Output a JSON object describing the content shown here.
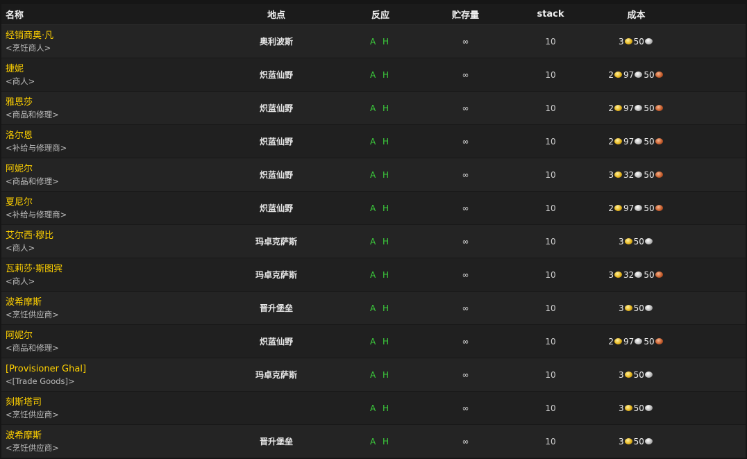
{
  "headers": {
    "name": "名称",
    "location": "地点",
    "react": "反应",
    "stock": "贮存量",
    "stack": "stack",
    "cost": "成本"
  },
  "rows": [
    {
      "name": "经销商奥·凡",
      "sub": "<烹饪商人>",
      "location": "奥利波斯",
      "react": "A H",
      "stock": "∞",
      "stack": "10",
      "gold": "3",
      "silver": "50",
      "copper": ""
    },
    {
      "name": "捷妮",
      "sub": "<商人>",
      "location": "炽蓝仙野",
      "react": "A H",
      "stock": "∞",
      "stack": "10",
      "gold": "2",
      "silver": "97",
      "copper": "50"
    },
    {
      "name": "雅恩莎",
      "sub": "<商品和修理>",
      "location": "炽蓝仙野",
      "react": "A H",
      "stock": "∞",
      "stack": "10",
      "gold": "2",
      "silver": "97",
      "copper": "50"
    },
    {
      "name": "洛尔恩",
      "sub": "<补给与修理商>",
      "location": "炽蓝仙野",
      "react": "A H",
      "stock": "∞",
      "stack": "10",
      "gold": "2",
      "silver": "97",
      "copper": "50"
    },
    {
      "name": "阿妮尔",
      "sub": "<商品和修理>",
      "location": "炽蓝仙野",
      "react": "A H",
      "stock": "∞",
      "stack": "10",
      "gold": "3",
      "silver": "32",
      "copper": "50"
    },
    {
      "name": "夏尼尔",
      "sub": "<补给与修理商>",
      "location": "炽蓝仙野",
      "react": "A H",
      "stock": "∞",
      "stack": "10",
      "gold": "2",
      "silver": "97",
      "copper": "50"
    },
    {
      "name": "艾尔西·穆比",
      "sub": "<商人>",
      "location": "玛卓克萨斯",
      "react": "A H",
      "stock": "∞",
      "stack": "10",
      "gold": "3",
      "silver": "50",
      "copper": ""
    },
    {
      "name": "瓦莉莎·斯图宾",
      "sub": "<商人>",
      "location": "玛卓克萨斯",
      "react": "A H",
      "stock": "∞",
      "stack": "10",
      "gold": "3",
      "silver": "32",
      "copper": "50"
    },
    {
      "name": "波希摩斯",
      "sub": "<烹饪供应商>",
      "location": "晋升堡垒",
      "react": "A H",
      "stock": "∞",
      "stack": "10",
      "gold": "3",
      "silver": "50",
      "copper": ""
    },
    {
      "name": "阿妮尔",
      "sub": "<商品和修理>",
      "location": "炽蓝仙野",
      "react": "A H",
      "stock": "∞",
      "stack": "10",
      "gold": "2",
      "silver": "97",
      "copper": "50"
    },
    {
      "name": "[Provisioner Ghal]",
      "sub": "<[Trade Goods]>",
      "location": "玛卓克萨斯",
      "react": "A H",
      "stock": "∞",
      "stack": "10",
      "gold": "3",
      "silver": "50",
      "copper": ""
    },
    {
      "name": "刻斯塔司",
      "sub": "<烹饪供应商>",
      "location": "",
      "react": "A H",
      "stock": "∞",
      "stack": "10",
      "gold": "3",
      "silver": "50",
      "copper": ""
    },
    {
      "name": "波希摩斯",
      "sub": "<烹饪供应商>",
      "location": "晋升堡垒",
      "react": "A H",
      "stock": "∞",
      "stack": "10",
      "gold": "3",
      "silver": "50",
      "copper": ""
    }
  ],
  "colors": {
    "npc_name": "#ffd100",
    "react": "#3ccf3c",
    "gold_coin": "#e5b51f",
    "silver_coin": "#bcbcbc",
    "copper_coin": "#c9602f"
  }
}
